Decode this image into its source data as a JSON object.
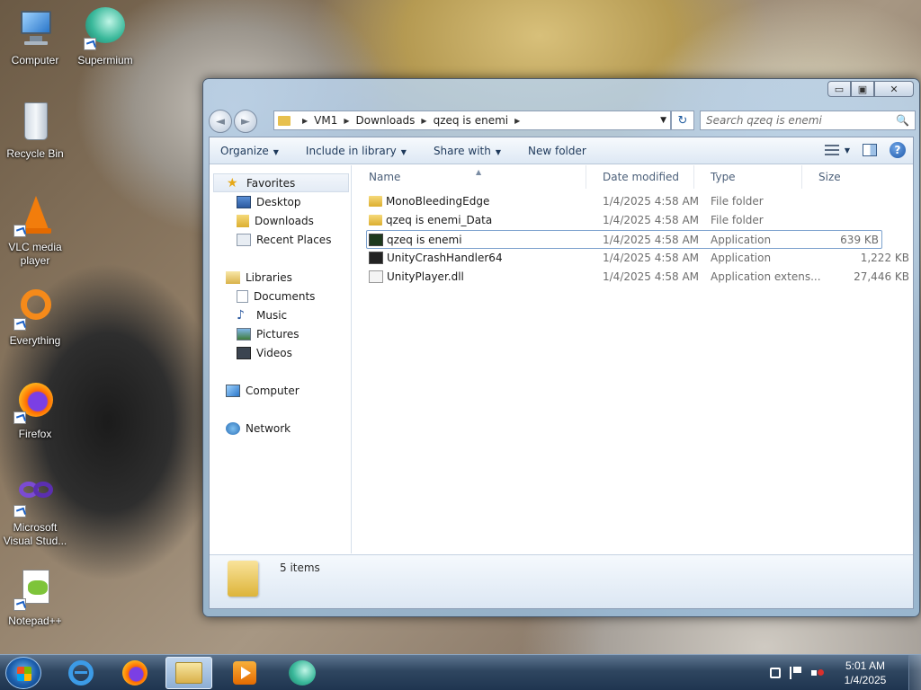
{
  "desktop": {
    "icons": [
      {
        "label": "Computer"
      },
      {
        "label": "Supermium"
      },
      {
        "label": "Recycle Bin"
      },
      {
        "label": "VLC media player"
      },
      {
        "label": "Everything"
      },
      {
        "label": "Firefox"
      },
      {
        "label": "Microsoft Visual Stud..."
      },
      {
        "label": "Notepad++"
      }
    ]
  },
  "window": {
    "controls": {
      "minimize": "▭",
      "maximize": "▣",
      "close": "✕"
    },
    "nav": {
      "back": "◄",
      "forward": "►"
    },
    "address": {
      "crumbs": [
        "VM1",
        "Downloads",
        "qzeq is enemi"
      ],
      "sep": "▶",
      "dropdown": "▼",
      "refresh": "↻"
    },
    "search": {
      "placeholder": "Search qzeq is enemi",
      "icon": "🔍"
    },
    "toolbar": {
      "organize": "Organize",
      "include": "Include in library",
      "share": "Share with",
      "new_folder": "New folder",
      "caret": "▼",
      "help": "?"
    },
    "navpane": {
      "favorites": "Favorites",
      "favorites_items": [
        "Desktop",
        "Downloads",
        "Recent Places"
      ],
      "libraries": "Libraries",
      "libraries_items": [
        "Documents",
        "Music",
        "Pictures",
        "Videos"
      ],
      "computer": "Computer",
      "network": "Network"
    },
    "columns": {
      "name": "Name",
      "date": "Date modified",
      "type": "Type",
      "size": "Size",
      "sort_indicator": "▲"
    },
    "files": [
      {
        "name": "MonoBleedingEdge",
        "date": "1/4/2025 4:58 AM",
        "type": "File folder",
        "size": ""
      },
      {
        "name": "qzeq is enemi_Data",
        "date": "1/4/2025 4:58 AM",
        "type": "File folder",
        "size": ""
      },
      {
        "name": "qzeq is enemi",
        "date": "1/4/2025 4:58 AM",
        "type": "Application",
        "size": "639 KB"
      },
      {
        "name": "UnityCrashHandler64",
        "date": "1/4/2025 4:58 AM",
        "type": "Application",
        "size": "1,222 KB"
      },
      {
        "name": "UnityPlayer.dll",
        "date": "1/4/2025 4:58 AM",
        "type": "Application extens...",
        "size": "27,446 KB"
      }
    ],
    "details": {
      "count": "5 items"
    }
  },
  "taskbar": {
    "clock": {
      "time": "5:01 AM",
      "date": "1/4/2025"
    }
  },
  "colors": {
    "selection_border": "#7da2ce",
    "toolbar_text": "#1e395b"
  }
}
